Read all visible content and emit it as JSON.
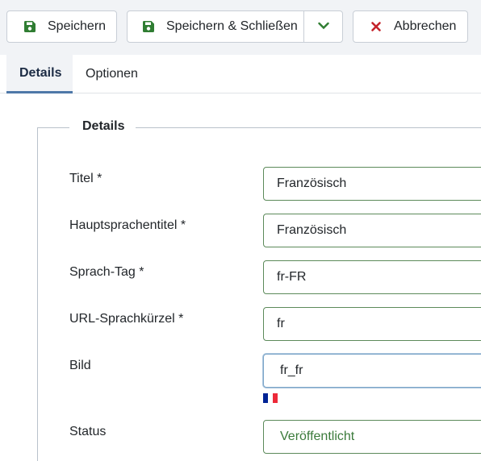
{
  "toolbar": {
    "save_label": "Speichern",
    "save_close_label": "Speichern & Schließen",
    "cancel_label": "Abbrechen",
    "save_icon": "save-icon",
    "dropdown_icon": "chevron-down-icon",
    "cancel_icon": "close-icon"
  },
  "tabs": [
    {
      "label": "Details",
      "active": true
    },
    {
      "label": "Optionen",
      "active": false
    }
  ],
  "fieldset": {
    "legend": "Details",
    "fields": [
      {
        "label": "Titel *",
        "value": "Französisch"
      },
      {
        "label": "Hauptsprachentitel *",
        "value": "Französisch"
      },
      {
        "label": "Sprach-Tag *",
        "value": "fr-FR"
      },
      {
        "label": "URL-Sprachkürzel *",
        "value": "fr"
      },
      {
        "label": "Bild",
        "value": "fr_fr"
      },
      {
        "label": "Status",
        "value": "Veröffentlicht"
      }
    ]
  },
  "colors": {
    "save_icon": "#2f7d32",
    "cancel_icon": "#c4232b",
    "active_tab_underline": "#4e78a8",
    "status_text": "#3a7a3a",
    "flag": [
      "#002395",
      "#ffffff",
      "#ed2939"
    ]
  }
}
